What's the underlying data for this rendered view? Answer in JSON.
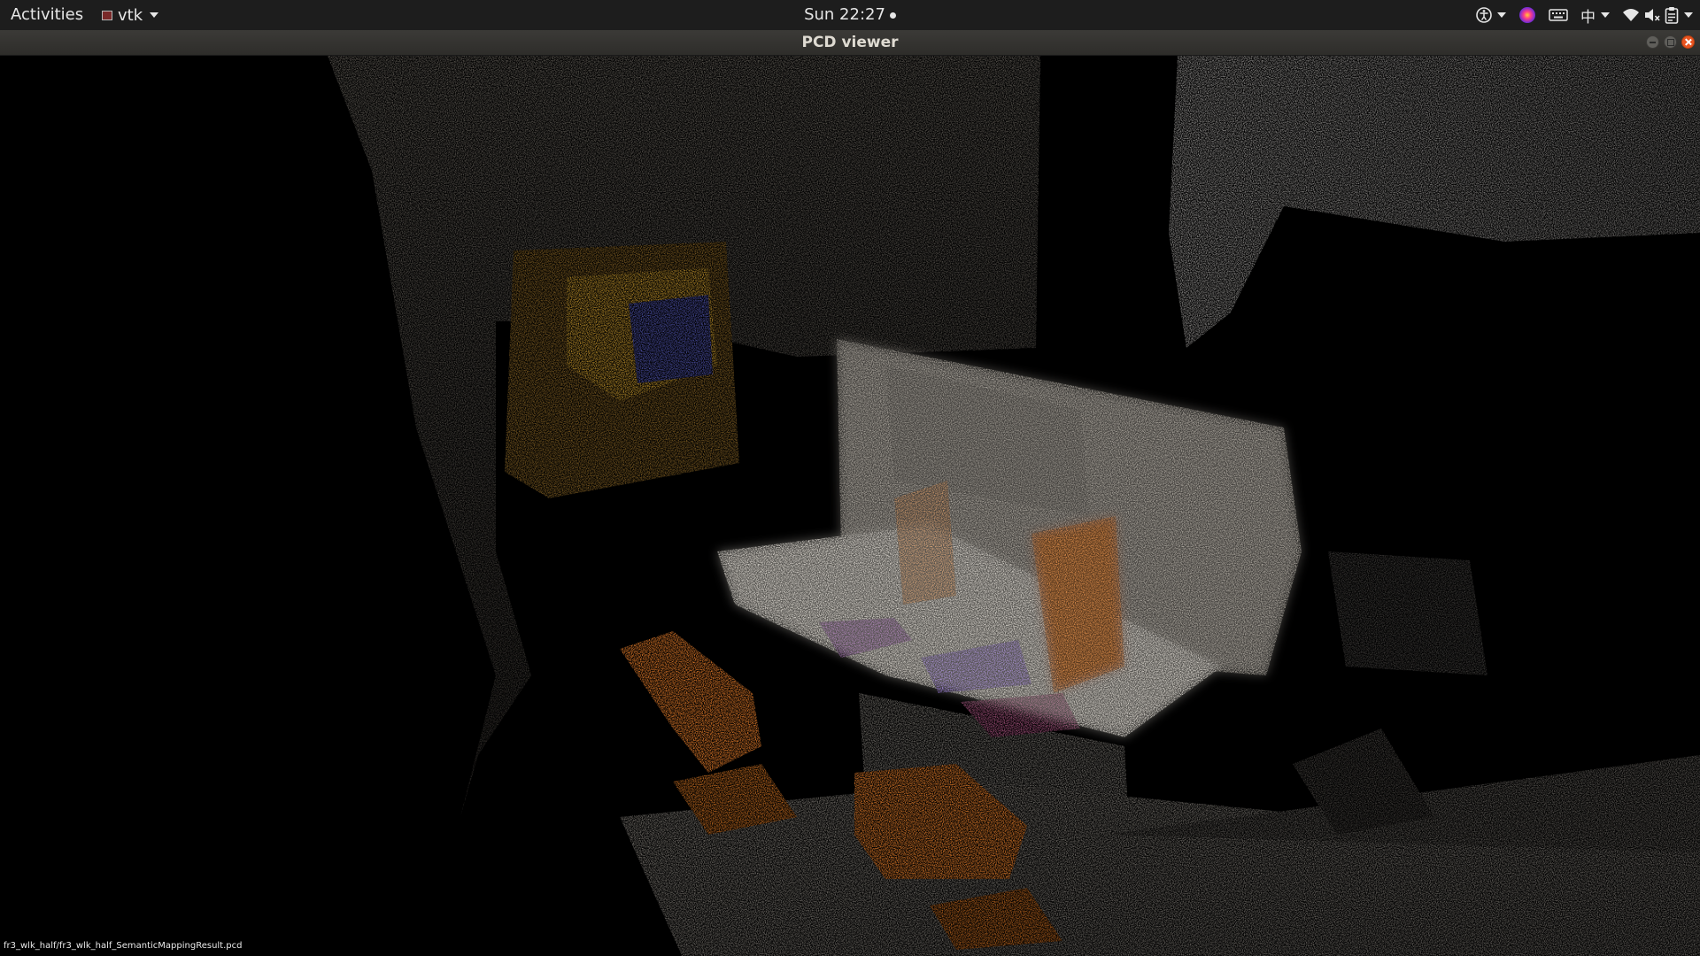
{
  "topbar": {
    "activities_label": "Activities",
    "app_menu_label": "vtk",
    "clock_label": "Sun 22:27",
    "input_method_label": "中",
    "icons": [
      "accessibility-icon",
      "color-picker-app-icon",
      "keyboard-icon",
      "input-method-icon",
      "wifi-icon",
      "volume-muted-icon",
      "clipboard-icon"
    ]
  },
  "window": {
    "title": "PCD viewer",
    "buttons": [
      "minimize",
      "maximize",
      "close"
    ]
  },
  "viewer": {
    "status_filename": "fr3_wlk_half/fr3_wlk_half_SemanticMappingResult.pcd",
    "background_color": "#000000",
    "segment_colors": {
      "chair": "#e07a2a",
      "monitor": "#d88a4a",
      "keyboard": "#9a5ab0",
      "book": "#8d6bd6",
      "desk": "#d8d4cc",
      "poster": "#b58a2a"
    }
  }
}
